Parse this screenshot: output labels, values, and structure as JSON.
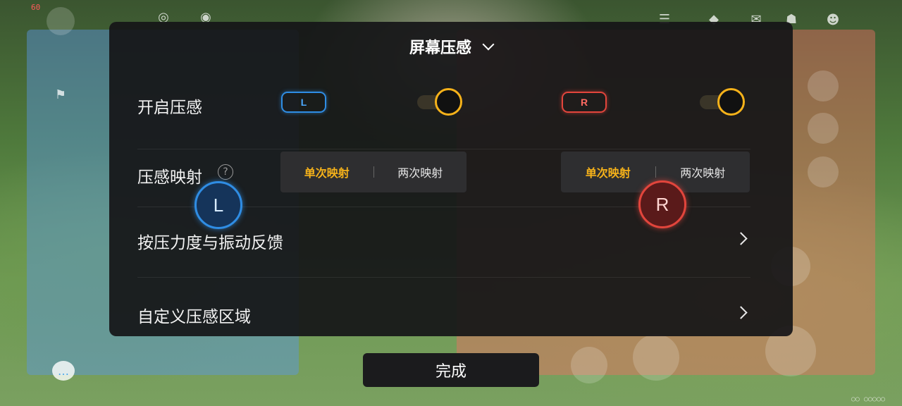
{
  "panel": {
    "title": "屏幕压感",
    "enable_row": {
      "label": "开启压感",
      "left_badge": "L",
      "right_badge": "R",
      "left_toggle_on": true,
      "right_toggle_on": true
    },
    "mapping_row": {
      "label": "压感映射",
      "help_icon": "?",
      "left_options": [
        "单次映射",
        "两次映射"
      ],
      "left_selected": "单次映射",
      "right_options": [
        "单次映射",
        "两次映射"
      ],
      "right_selected": "单次映射"
    },
    "pressure_row": {
      "label": "按压力度与振动反馈"
    },
    "custom_row": {
      "label": "自定义压感区域"
    }
  },
  "markers": {
    "left": "L",
    "right": "R"
  },
  "footer": {
    "done_label": "完成"
  },
  "hud": {
    "fps_text": "60"
  },
  "colors": {
    "accent": "#f6b21a",
    "left_blue": "#2f8de4",
    "right_red": "#e2453c",
    "panel_bg": "#161618"
  },
  "icons": [
    "chevron-down-icon",
    "help-icon",
    "chevron-right-icon",
    "chat-icon",
    "menu-icon",
    "quest-icon"
  ]
}
